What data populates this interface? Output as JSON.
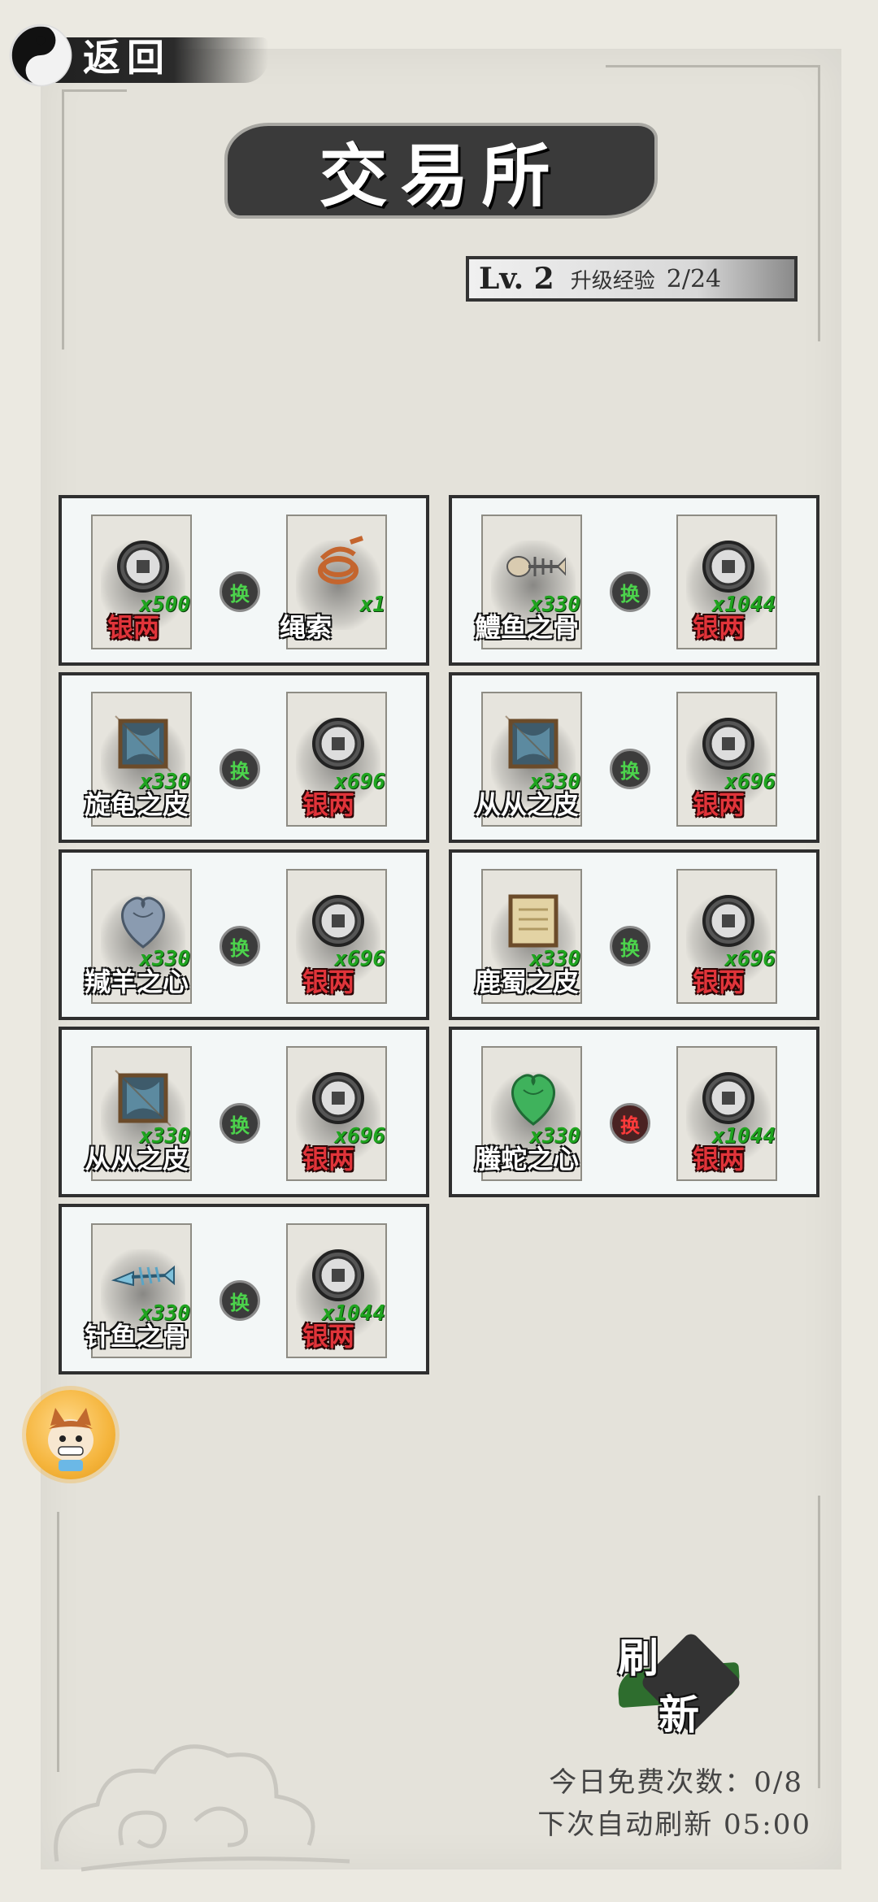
{
  "header": {
    "back_label": "返回",
    "title": "交易所",
    "level": "Lv. 2",
    "exp_label": "升级经验",
    "exp_value": "2/24"
  },
  "swap_label": "换",
  "trades": [
    {
      "give": {
        "name": "银两",
        "qty": "x500",
        "icon": "coin-icon"
      },
      "get": {
        "name": "绳索",
        "qty": "x1",
        "icon": "rope-icon"
      },
      "swap_style": "green"
    },
    {
      "give": {
        "name": "鱧鱼之骨",
        "qty": "x330",
        "icon": "fish-bone-icon"
      },
      "get": {
        "name": "银两",
        "qty": "x1044",
        "icon": "coin-icon"
      },
      "swap_style": "green"
    },
    {
      "give": {
        "name": "旋龟之皮",
        "qty": "x330",
        "icon": "framed-hide-icon"
      },
      "get": {
        "name": "银两",
        "qty": "x696",
        "icon": "coin-icon"
      },
      "swap_style": "green"
    },
    {
      "give": {
        "name": "从从之皮",
        "qty": "x330",
        "icon": "framed-hide-icon"
      },
      "get": {
        "name": "银两",
        "qty": "x696",
        "icon": "coin-icon"
      },
      "swap_style": "green"
    },
    {
      "give": {
        "name": "羬羊之心",
        "qty": "x330",
        "icon": "grey-heart-icon"
      },
      "get": {
        "name": "银两",
        "qty": "x696",
        "icon": "coin-icon"
      },
      "swap_style": "green"
    },
    {
      "give": {
        "name": "鹿蜀之皮",
        "qty": "x330",
        "icon": "scroll-hide-icon"
      },
      "get": {
        "name": "银两",
        "qty": "x696",
        "icon": "coin-icon"
      },
      "swap_style": "green"
    },
    {
      "give": {
        "name": "从从之皮",
        "qty": "x330",
        "icon": "framed-hide-icon"
      },
      "get": {
        "name": "银两",
        "qty": "x696",
        "icon": "coin-icon"
      },
      "swap_style": "green"
    },
    {
      "give": {
        "name": "螣蛇之心",
        "qty": "x330",
        "icon": "green-heart-icon"
      },
      "get": {
        "name": "银两",
        "qty": "x1044",
        "icon": "coin-icon"
      },
      "swap_style": "red"
    },
    {
      "give": {
        "name": "针鱼之骨",
        "qty": "x330",
        "icon": "blue-fish-bone-icon"
      },
      "get": {
        "name": "银两",
        "qty": "x1044",
        "icon": "coin-icon"
      },
      "swap_style": "green"
    }
  ],
  "refresh": {
    "char1": "刷",
    "char2": "新",
    "free_count": "今日免费次数：0/8",
    "auto_refresh": "下次自动刷新 05:00"
  },
  "colors": {
    "background": "#ebe9e1",
    "card": "#f3f7f7",
    "qty_green": "#1fa41f",
    "silver_red": "#e0343a",
    "refresh_green": "#2e6d2e"
  }
}
